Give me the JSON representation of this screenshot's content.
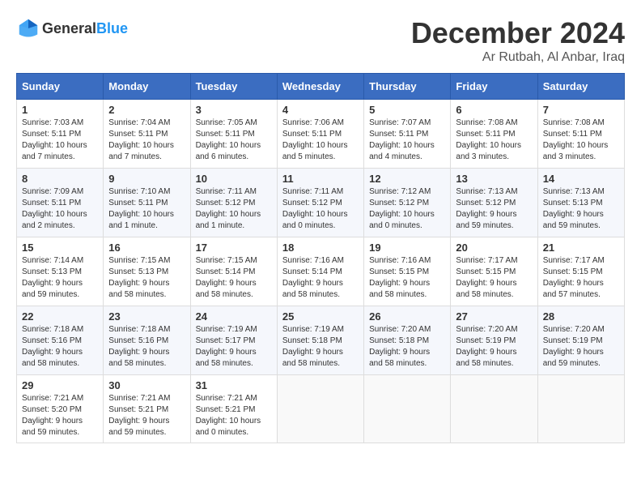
{
  "logo": {
    "text_general": "General",
    "text_blue": "Blue"
  },
  "title": {
    "month_year": "December 2024",
    "location": "Ar Rutbah, Al Anbar, Iraq"
  },
  "headers": [
    "Sunday",
    "Monday",
    "Tuesday",
    "Wednesday",
    "Thursday",
    "Friday",
    "Saturday"
  ],
  "weeks": [
    [
      {
        "day": "1",
        "sunrise": "Sunrise: 7:03 AM",
        "sunset": "Sunset: 5:11 PM",
        "daylight": "Daylight: 10 hours and 7 minutes."
      },
      {
        "day": "2",
        "sunrise": "Sunrise: 7:04 AM",
        "sunset": "Sunset: 5:11 PM",
        "daylight": "Daylight: 10 hours and 7 minutes."
      },
      {
        "day": "3",
        "sunrise": "Sunrise: 7:05 AM",
        "sunset": "Sunset: 5:11 PM",
        "daylight": "Daylight: 10 hours and 6 minutes."
      },
      {
        "day": "4",
        "sunrise": "Sunrise: 7:06 AM",
        "sunset": "Sunset: 5:11 PM",
        "daylight": "Daylight: 10 hours and 5 minutes."
      },
      {
        "day": "5",
        "sunrise": "Sunrise: 7:07 AM",
        "sunset": "Sunset: 5:11 PM",
        "daylight": "Daylight: 10 hours and 4 minutes."
      },
      {
        "day": "6",
        "sunrise": "Sunrise: 7:08 AM",
        "sunset": "Sunset: 5:11 PM",
        "daylight": "Daylight: 10 hours and 3 minutes."
      },
      {
        "day": "7",
        "sunrise": "Sunrise: 7:08 AM",
        "sunset": "Sunset: 5:11 PM",
        "daylight": "Daylight: 10 hours and 3 minutes."
      }
    ],
    [
      {
        "day": "8",
        "sunrise": "Sunrise: 7:09 AM",
        "sunset": "Sunset: 5:11 PM",
        "daylight": "Daylight: 10 hours and 2 minutes."
      },
      {
        "day": "9",
        "sunrise": "Sunrise: 7:10 AM",
        "sunset": "Sunset: 5:11 PM",
        "daylight": "Daylight: 10 hours and 1 minute."
      },
      {
        "day": "10",
        "sunrise": "Sunrise: 7:11 AM",
        "sunset": "Sunset: 5:12 PM",
        "daylight": "Daylight: 10 hours and 1 minute."
      },
      {
        "day": "11",
        "sunrise": "Sunrise: 7:11 AM",
        "sunset": "Sunset: 5:12 PM",
        "daylight": "Daylight: 10 hours and 0 minutes."
      },
      {
        "day": "12",
        "sunrise": "Sunrise: 7:12 AM",
        "sunset": "Sunset: 5:12 PM",
        "daylight": "Daylight: 10 hours and 0 minutes."
      },
      {
        "day": "13",
        "sunrise": "Sunrise: 7:13 AM",
        "sunset": "Sunset: 5:12 PM",
        "daylight": "Daylight: 9 hours and 59 minutes."
      },
      {
        "day": "14",
        "sunrise": "Sunrise: 7:13 AM",
        "sunset": "Sunset: 5:13 PM",
        "daylight": "Daylight: 9 hours and 59 minutes."
      }
    ],
    [
      {
        "day": "15",
        "sunrise": "Sunrise: 7:14 AM",
        "sunset": "Sunset: 5:13 PM",
        "daylight": "Daylight: 9 hours and 59 minutes."
      },
      {
        "day": "16",
        "sunrise": "Sunrise: 7:15 AM",
        "sunset": "Sunset: 5:13 PM",
        "daylight": "Daylight: 9 hours and 58 minutes."
      },
      {
        "day": "17",
        "sunrise": "Sunrise: 7:15 AM",
        "sunset": "Sunset: 5:14 PM",
        "daylight": "Daylight: 9 hours and 58 minutes."
      },
      {
        "day": "18",
        "sunrise": "Sunrise: 7:16 AM",
        "sunset": "Sunset: 5:14 PM",
        "daylight": "Daylight: 9 hours and 58 minutes."
      },
      {
        "day": "19",
        "sunrise": "Sunrise: 7:16 AM",
        "sunset": "Sunset: 5:15 PM",
        "daylight": "Daylight: 9 hours and 58 minutes."
      },
      {
        "day": "20",
        "sunrise": "Sunrise: 7:17 AM",
        "sunset": "Sunset: 5:15 PM",
        "daylight": "Daylight: 9 hours and 58 minutes."
      },
      {
        "day": "21",
        "sunrise": "Sunrise: 7:17 AM",
        "sunset": "Sunset: 5:15 PM",
        "daylight": "Daylight: 9 hours and 57 minutes."
      }
    ],
    [
      {
        "day": "22",
        "sunrise": "Sunrise: 7:18 AM",
        "sunset": "Sunset: 5:16 PM",
        "daylight": "Daylight: 9 hours and 58 minutes."
      },
      {
        "day": "23",
        "sunrise": "Sunrise: 7:18 AM",
        "sunset": "Sunset: 5:16 PM",
        "daylight": "Daylight: 9 hours and 58 minutes."
      },
      {
        "day": "24",
        "sunrise": "Sunrise: 7:19 AM",
        "sunset": "Sunset: 5:17 PM",
        "daylight": "Daylight: 9 hours and 58 minutes."
      },
      {
        "day": "25",
        "sunrise": "Sunrise: 7:19 AM",
        "sunset": "Sunset: 5:18 PM",
        "daylight": "Daylight: 9 hours and 58 minutes."
      },
      {
        "day": "26",
        "sunrise": "Sunrise: 7:20 AM",
        "sunset": "Sunset: 5:18 PM",
        "daylight": "Daylight: 9 hours and 58 minutes."
      },
      {
        "day": "27",
        "sunrise": "Sunrise: 7:20 AM",
        "sunset": "Sunset: 5:19 PM",
        "daylight": "Daylight: 9 hours and 58 minutes."
      },
      {
        "day": "28",
        "sunrise": "Sunrise: 7:20 AM",
        "sunset": "Sunset: 5:19 PM",
        "daylight": "Daylight: 9 hours and 59 minutes."
      }
    ],
    [
      {
        "day": "29",
        "sunrise": "Sunrise: 7:21 AM",
        "sunset": "Sunset: 5:20 PM",
        "daylight": "Daylight: 9 hours and 59 minutes."
      },
      {
        "day": "30",
        "sunrise": "Sunrise: 7:21 AM",
        "sunset": "Sunset: 5:21 PM",
        "daylight": "Daylight: 9 hours and 59 minutes."
      },
      {
        "day": "31",
        "sunrise": "Sunrise: 7:21 AM",
        "sunset": "Sunset: 5:21 PM",
        "daylight": "Daylight: 10 hours and 0 minutes."
      },
      null,
      null,
      null,
      null
    ]
  ]
}
